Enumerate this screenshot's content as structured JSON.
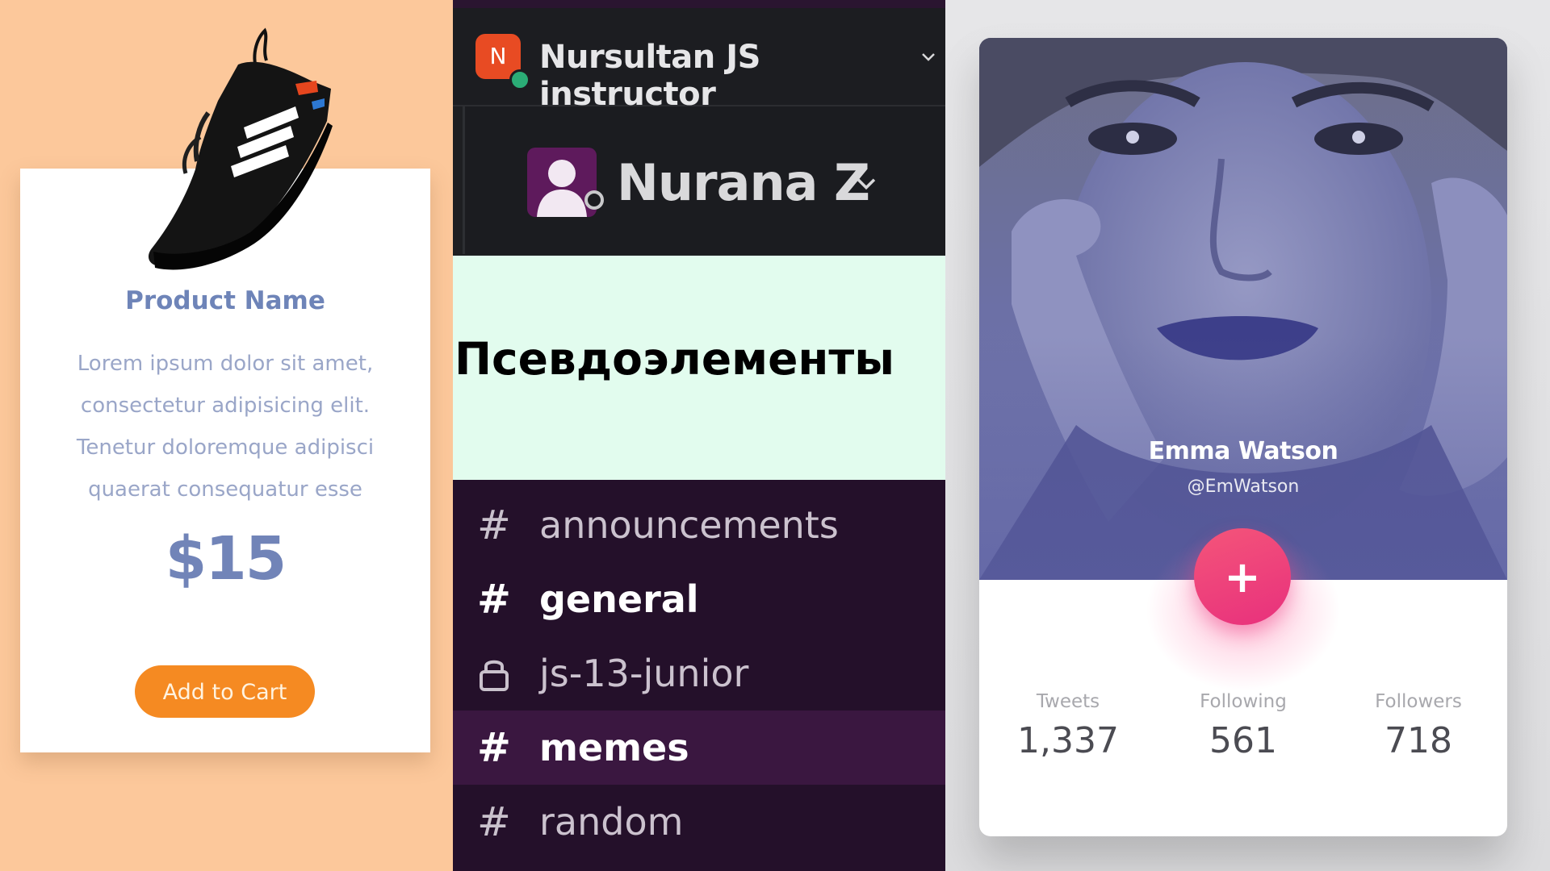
{
  "product_card": {
    "name": "Product Name",
    "description": "Lorem ipsum dolor sit amet, consectetur adipisicing elit. Tenetur doloremque adipisci quaerat consequatur esse",
    "price": "$15",
    "button_label": "Add to Cart",
    "image_icon": "sneaker-image",
    "colors": {
      "background": "#fcc89b",
      "button": "#f58a22",
      "text": "#6e84b8"
    }
  },
  "slack_panel": {
    "workspace": {
      "avatar_letter": "N",
      "name": "Nursultan JS instructor"
    },
    "user": {
      "name": "Nurana Z"
    },
    "title": "Псевдоэлементы",
    "channels": [
      {
        "icon": "#",
        "label": "announcements",
        "bold": false,
        "active": false
      },
      {
        "icon": "#",
        "label": "general",
        "bold": true,
        "active": false
      },
      {
        "icon": "lock-icon",
        "label": "js-13-junior",
        "bold": false,
        "active": false
      },
      {
        "icon": "#",
        "label": "memes",
        "bold": true,
        "active": true
      },
      {
        "icon": "#",
        "label": "random",
        "bold": false,
        "active": false
      }
    ],
    "colors": {
      "sidebar": "#24102a",
      "active": "#3a1740",
      "banner": "#e2fcee",
      "status_online": "#2bac76"
    }
  },
  "profile_card": {
    "name": "Emma Watson",
    "handle": "@EmWatson",
    "follow_button": "+",
    "stats": [
      {
        "label": "Tweets",
        "value": "1,337"
      },
      {
        "label": "Following",
        "value": "561"
      },
      {
        "label": "Followers",
        "value": "718"
      }
    ],
    "colors": {
      "overlay": "#5c62a8",
      "fab": "#f0407c"
    }
  }
}
